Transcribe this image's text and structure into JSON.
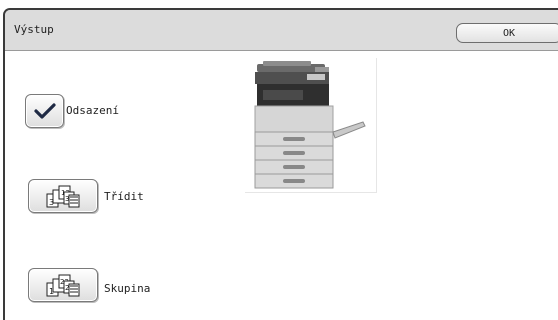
{
  "window": {
    "title": "Výstup",
    "ok_label": "OK"
  },
  "options": [
    {
      "label": "Odsazení",
      "checked": true,
      "icon": "checkmark-icon"
    },
    {
      "label": "Třídit",
      "checked": false,
      "icon": "sort-stack-icon"
    },
    {
      "label": "Skupina",
      "checked": false,
      "icon": "group-stack-icon"
    }
  ],
  "illustration": {
    "icon": "copier-machine-icon"
  },
  "colors": {
    "titlebar": "#dcdcdc",
    "frame": "#3a3a3a",
    "check": "#1f2a44"
  }
}
